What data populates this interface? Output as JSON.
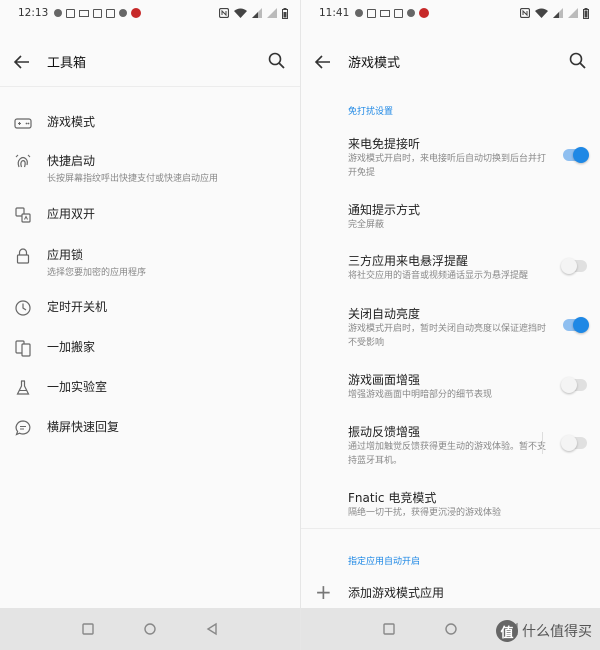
{
  "left_screen": {
    "status": {
      "time": "12:13"
    },
    "toolbar": {
      "title": "工具箱"
    },
    "items": [
      {
        "label": "游戏模式",
        "sub": ""
      },
      {
        "label": "快捷启动",
        "sub": "长按屏幕指纹呼出快捷支付或快速启动应用"
      },
      {
        "label": "应用双开",
        "sub": ""
      },
      {
        "label": "应用锁",
        "sub": "选择您要加密的应用程序"
      },
      {
        "label": "定时开关机",
        "sub": ""
      },
      {
        "label": "一加搬家",
        "sub": ""
      },
      {
        "label": "一加实验室",
        "sub": ""
      },
      {
        "label": "横屏快速回复",
        "sub": ""
      }
    ]
  },
  "right_screen": {
    "status": {
      "time": "11:41"
    },
    "toolbar": {
      "title": "游戏模式"
    },
    "section1": "免打扰设置",
    "settings": [
      {
        "label": "来电免提接听",
        "sub": "游戏模式开启时，来电接听后自动切换到后台并打开免提",
        "toggle": true
      },
      {
        "label": "通知提示方式",
        "sub": "完全屏蔽",
        "toggle": null
      },
      {
        "label": "三方应用来电悬浮提醒",
        "sub": "将社交应用的语音或视频通话显示为悬浮提醒",
        "toggle": false
      },
      {
        "label": "关闭自动亮度",
        "sub": "游戏模式开启时，暂时关闭自动亮度以保证遮挡时不受影响",
        "toggle": true
      },
      {
        "label": "游戏画面增强",
        "sub": "增强游戏画面中明暗部分的细节表现",
        "toggle": false
      },
      {
        "label": "振动反馈增强",
        "sub": "通过增加触觉反馈获得更生动的游戏体验。暂不支持蓝牙耳机。",
        "toggle": false
      },
      {
        "label": "Fnatic 电竞模式",
        "sub": "隔绝一切干扰，获得更沉浸的游戏体验",
        "toggle": null
      }
    ],
    "section2": "指定应用自动开启",
    "add_label": "添加游戏模式应用"
  },
  "watermark": {
    "badge": "值",
    "text": "什么值得买"
  },
  "colors": {
    "accent": "#1e88e5",
    "toggle_track_on": "#8fbff0",
    "navbar": "#e4e4e4"
  }
}
